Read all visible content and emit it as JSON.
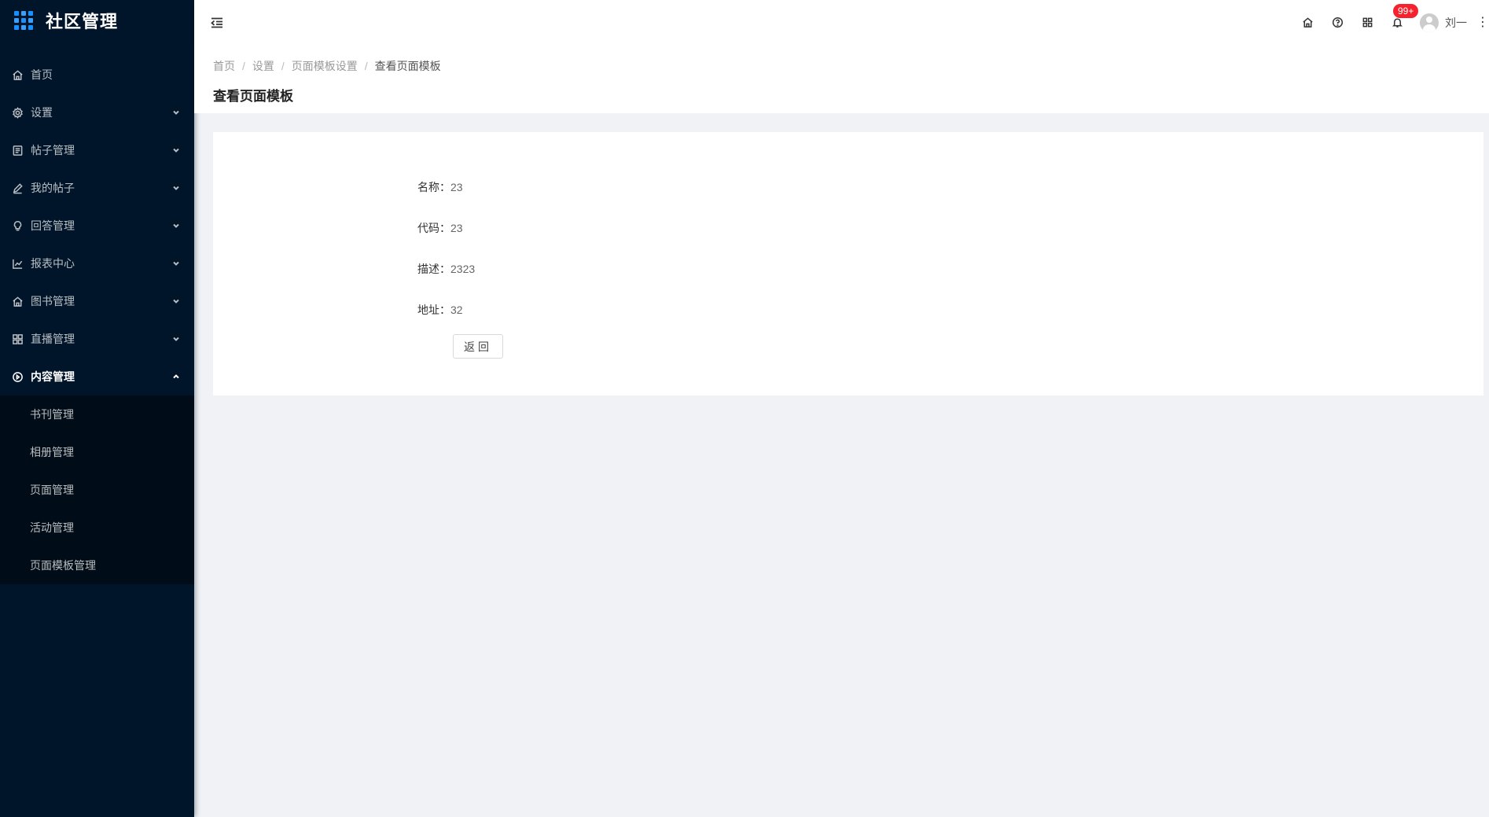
{
  "app": {
    "title": "社区管理"
  },
  "sidebar": {
    "items": [
      {
        "label": "首页",
        "icon": "home-icon",
        "has_arrow": false
      },
      {
        "label": "设置",
        "icon": "gear-icon",
        "has_arrow": true
      },
      {
        "label": "帖子管理",
        "icon": "document-icon",
        "has_arrow": true
      },
      {
        "label": "我的帖子",
        "icon": "edit-icon",
        "has_arrow": true
      },
      {
        "label": "回答管理",
        "icon": "bulb-icon",
        "has_arrow": true
      },
      {
        "label": "报表中心",
        "icon": "line-chart-icon",
        "has_arrow": true
      },
      {
        "label": "图书管理",
        "icon": "home-icon",
        "has_arrow": true
      },
      {
        "label": "直播管理",
        "icon": "grid-icon",
        "has_arrow": true
      },
      {
        "label": "内容管理",
        "icon": "play-circle-icon",
        "has_arrow": true,
        "expanded": true
      }
    ],
    "submenu": [
      {
        "label": "书刊管理"
      },
      {
        "label": "相册管理"
      },
      {
        "label": "页面管理"
      },
      {
        "label": "活动管理"
      },
      {
        "label": "页面模板管理"
      }
    ]
  },
  "header": {
    "notification_badge": "99+",
    "user_name": "刘一"
  },
  "breadcrumb": [
    "首页",
    "设置",
    "页面模板设置",
    "查看页面模板"
  ],
  "page_title": "查看页面模板",
  "details": [
    {
      "label": "名称：",
      "value": "23"
    },
    {
      "label": "代码：",
      "value": "23"
    },
    {
      "label": "描述：",
      "value": "2323"
    },
    {
      "label": "地址：",
      "value": "32"
    }
  ],
  "actions": {
    "back_label": "返回"
  },
  "colors": {
    "sidebar_bg": "#001529",
    "submenu_bg": "#000c17",
    "accent": "#1890ff",
    "badge": "#f5222d",
    "page_bg": "#f0f2f5"
  }
}
